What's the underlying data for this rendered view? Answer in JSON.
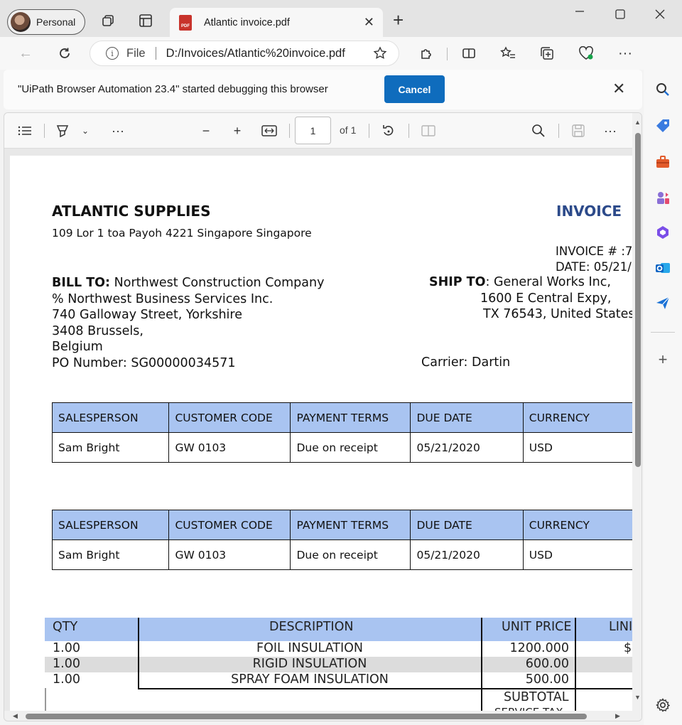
{
  "browser": {
    "profile_label": "Personal",
    "tab_title": "Atlantic invoice.pdf",
    "pdf_badge": "PDF",
    "address": {
      "file_label": "File",
      "url": "D:/Invoices/Atlantic%20invoice.pdf"
    }
  },
  "infobar": {
    "message": "\"UiPath Browser Automation 23.4\" started debugging this browser",
    "cancel_label": "Cancel"
  },
  "pdf_toolbar": {
    "page_value": "1",
    "of_label": "of 1"
  },
  "invoice": {
    "company": "ATLANTIC SUPPLIES",
    "company_address": "109 Lor 1 toa Payoh 4221 Singapore Singapore",
    "title": "INVOICE",
    "invoice_number": "INVOICE # :7",
    "date": "DATE: 05/21/",
    "bill_to_label": "BILL TO:",
    "bill_to_lines": [
      "Northwest Construction Company",
      "% Northwest Business Services Inc.",
      "740 Galloway Street, Yorkshire",
      "3408 Brussels,",
      "Belgium"
    ],
    "po_number": "PO Number: SG00000034571",
    "ship_to_label": "SHIP TO",
    "ship_to_lines": [
      ": General Works Inc,",
      "1600 E Central Expy,",
      "TX 76543, United States"
    ],
    "carrier": "Carrier: Dartin",
    "info_table": {
      "headers": [
        "SALESPERSON",
        "CUSTOMER CODE",
        "PAYMENT TERMS",
        "DUE DATE",
        "CURRENCY"
      ],
      "row": [
        "Sam Bright",
        "GW 0103",
        "Due on receipt",
        "05/21/2020",
        "USD"
      ]
    },
    "items": {
      "headers": [
        "QTY",
        "DESCRIPTION",
        "UNIT PRICE",
        "LINI"
      ],
      "rows": [
        {
          "qty": "1.00",
          "description": "FOIL INSULATION",
          "unit_price": "1200.000",
          "line": "$"
        },
        {
          "qty": "1.00",
          "description": "RIGID INSULATION",
          "unit_price": "600.00",
          "line": ""
        },
        {
          "qty": "1.00",
          "description": "SPRAY FOAM INSULATION",
          "unit_price": "500.00",
          "line": ""
        }
      ],
      "subtotal_label": "SUBTOTAL",
      "next_label_partial": "SERVICE TAX"
    }
  }
}
